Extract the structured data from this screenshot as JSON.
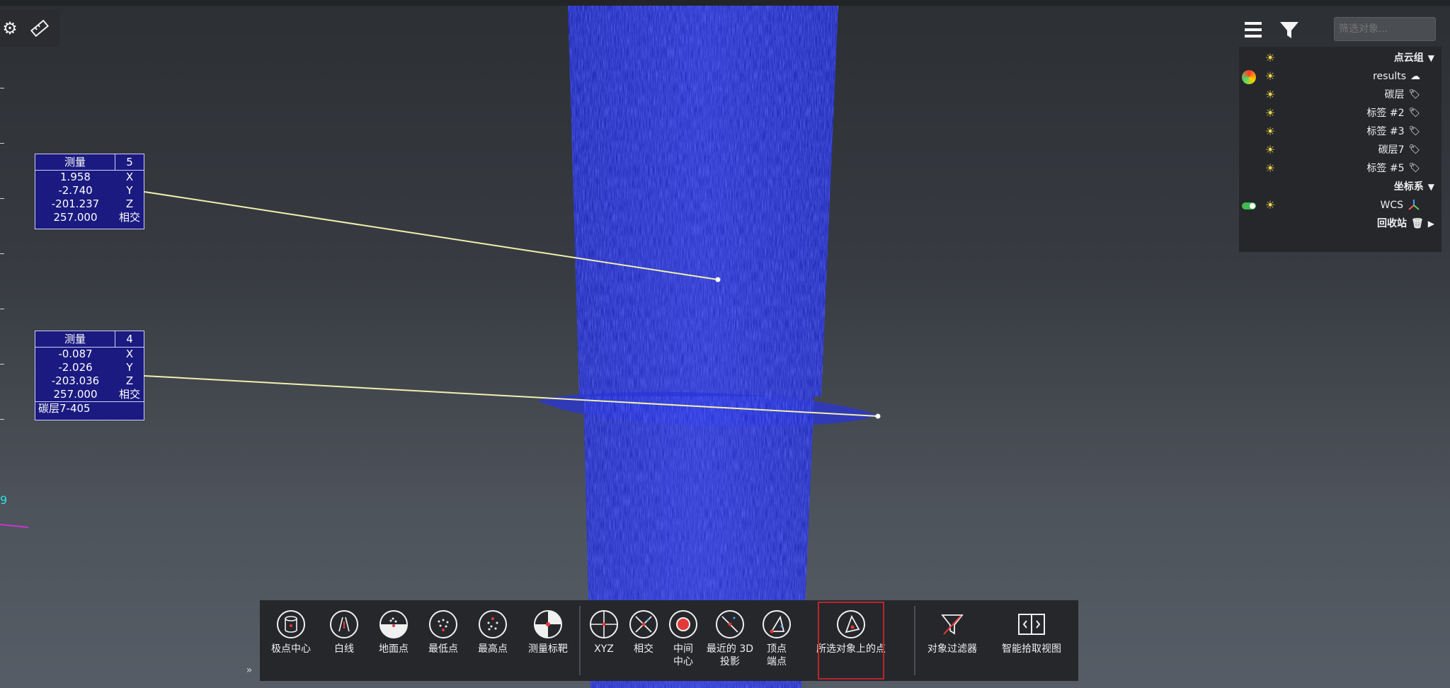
{
  "top_left_tools": [
    {
      "name": "tool-icon",
      "glyph": "⚙"
    },
    {
      "name": "ruler-icon",
      "glyph": "📏"
    }
  ],
  "measurements": [
    {
      "id": "5",
      "title": "测量",
      "rows": [
        {
          "value": "1.958",
          "axis": "X"
        },
        {
          "value": "-2.740",
          "axis": "Y"
        },
        {
          "value": "-201.237",
          "axis": "Z"
        },
        {
          "value": "257.000",
          "axis": "相交"
        }
      ],
      "footer": ""
    },
    {
      "id": "4",
      "title": "测量",
      "rows": [
        {
          "value": "-0.087",
          "axis": "X"
        },
        {
          "value": "-2.026",
          "axis": "Y"
        },
        {
          "value": "-203.036",
          "axis": "Z"
        },
        {
          "value": "257.000",
          "axis": "相交"
        }
      ],
      "footer": "碳层7-405"
    }
  ],
  "right_panel": {
    "filter_placeholder": "筛选对象...",
    "tree": {
      "point_cloud_group": "点云组",
      "items": [
        {
          "label": "results",
          "icon": "cloud-icon"
        },
        {
          "label": "碳层",
          "icon": "tag-icon"
        },
        {
          "label": "标签 #2",
          "icon": "tag-icon"
        },
        {
          "label": "标签 #3",
          "icon": "tag-icon"
        },
        {
          "label": "碳层7",
          "icon": "tag-icon"
        },
        {
          "label": "标签 #5",
          "icon": "tag-icon"
        }
      ],
      "coord_group": "坐标系",
      "coord_items": [
        {
          "label": "WCS",
          "icon": "axes-icon"
        }
      ],
      "recycle": "回收站"
    }
  },
  "toolbar": {
    "buttons": [
      {
        "id": "smart-view",
        "label": "智能拾取视图",
        "icon": "split-view-icon"
      },
      {
        "id": "object-filter",
        "label": "对象过滤器",
        "icon": "filter-off-icon"
      },
      {
        "id": "points-on-object",
        "label": "所选对象上的点",
        "icon": "triangle-point-icon",
        "selected": true
      },
      {
        "id": "vertex-endpoint",
        "label": "顶点\n端点",
        "icon": "vertex-icon"
      },
      {
        "id": "nearest-3d",
        "label": "最近的 3D\n投影",
        "icon": "nearest-icon"
      },
      {
        "id": "midpoint",
        "label": "中间\n中心",
        "icon": "midpoint-icon"
      },
      {
        "id": "intersect",
        "label": "相交",
        "icon": "intersect-icon"
      },
      {
        "id": "xyz",
        "label": "XYZ",
        "icon": "crosshair-icon"
      },
      {
        "id": "measure-target",
        "label": "测量标靶",
        "icon": "target-icon"
      },
      {
        "id": "highest-point",
        "label": "最高点",
        "icon": "highest-point-icon"
      },
      {
        "id": "lowest-point",
        "label": "最低点",
        "icon": "lowest-point-icon"
      },
      {
        "id": "ground-point",
        "label": "地面点",
        "icon": "ground-point-icon"
      },
      {
        "id": "white-line",
        "label": "白线",
        "icon": "road-line-icon"
      },
      {
        "id": "pole-center",
        "label": "极点中心",
        "icon": "cylinder-icon"
      }
    ]
  },
  "colors": {
    "cloud": "#2a3ae8",
    "label_bg": "#1a1a80",
    "leader_line": "#f2efb0",
    "selected_outline": "#b8262c",
    "sun": "#f5d94a"
  }
}
